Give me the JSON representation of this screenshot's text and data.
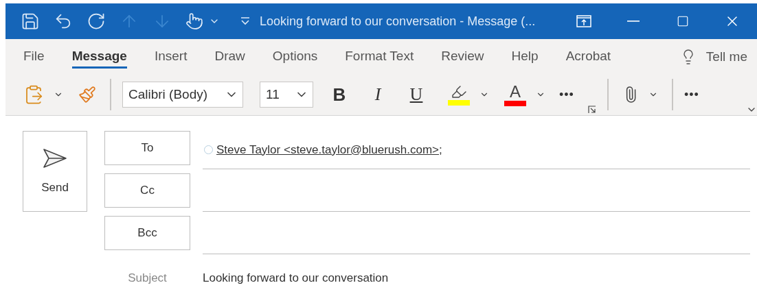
{
  "window": {
    "title": "Looking forward to our conversation  -  Message (...",
    "quick_access": [
      {
        "kind": "save",
        "disabled": false
      },
      {
        "kind": "undo",
        "disabled": false
      },
      {
        "kind": "redo",
        "disabled": false
      },
      {
        "kind": "up",
        "disabled": true
      },
      {
        "kind": "down",
        "disabled": true
      },
      {
        "kind": "touch",
        "disabled": false
      },
      {
        "kind": "customize",
        "disabled": false
      }
    ],
    "controls": [
      {
        "kind": "popout"
      },
      {
        "kind": "minimize"
      },
      {
        "kind": "maximize"
      },
      {
        "kind": "close"
      }
    ]
  },
  "tabs": [
    {
      "label": "File",
      "selected": false
    },
    {
      "label": "Message",
      "selected": true
    },
    {
      "label": "Insert",
      "selected": false
    },
    {
      "label": "Draw",
      "selected": false
    },
    {
      "label": "Options",
      "selected": false
    },
    {
      "label": "Format Text",
      "selected": false
    },
    {
      "label": "Review",
      "selected": false
    },
    {
      "label": "Help",
      "selected": false
    },
    {
      "label": "Acrobat",
      "selected": false
    }
  ],
  "tell_me": {
    "label": "Tell me"
  },
  "toolbar": [
    {
      "kind": "paste"
    },
    {
      "kind": "format-painter"
    },
    {
      "kind": "separator"
    },
    {
      "kind": "font",
      "value": "Calibri (Body)"
    },
    {
      "kind": "size",
      "value": "11"
    },
    {
      "kind": "bold",
      "label": "B"
    },
    {
      "kind": "italic",
      "label": "I"
    },
    {
      "kind": "underline",
      "label": "U"
    },
    {
      "kind": "highlight",
      "color": "#ffff00"
    },
    {
      "kind": "font-color",
      "label": "A",
      "color": "#ff0000"
    },
    {
      "kind": "more",
      "label": "•••"
    },
    {
      "kind": "launcher"
    },
    {
      "kind": "separator"
    },
    {
      "kind": "attach"
    },
    {
      "kind": "separator"
    },
    {
      "kind": "more",
      "label": "•••"
    }
  ],
  "compose": {
    "send": "Send",
    "fields": [
      {
        "label": "To",
        "recipient": "Steve Taylor <steve.taylor@bluerush.com>",
        "separator": ";"
      },
      {
        "label": "Cc"
      },
      {
        "label": "Bcc"
      }
    ],
    "subject": {
      "label": "Subject",
      "value": "Looking forward to our conversation"
    }
  }
}
